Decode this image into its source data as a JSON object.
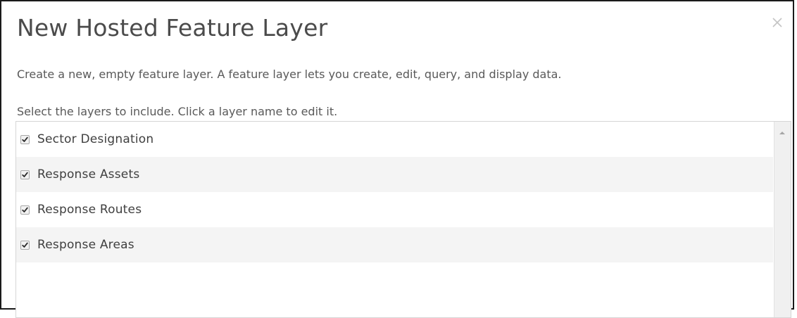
{
  "dialog": {
    "title": "New Hosted Feature Layer",
    "close_icon": "close-icon",
    "description": "Create a new, empty feature layer. A feature layer lets you create, edit, query, and display data.",
    "instructions": "Select the layers to include. Click a layer name to edit it."
  },
  "layers": [
    {
      "label": "Sector Designation",
      "checked": true
    },
    {
      "label": "Response Assets",
      "checked": true
    },
    {
      "label": "Response Routes",
      "checked": true
    },
    {
      "label": "Response Areas",
      "checked": true
    }
  ],
  "colors": {
    "title_text": "#4b4b4b",
    "body_text": "#595959",
    "row_alt": "#f4f4f4",
    "border": "#d6d6d6"
  }
}
